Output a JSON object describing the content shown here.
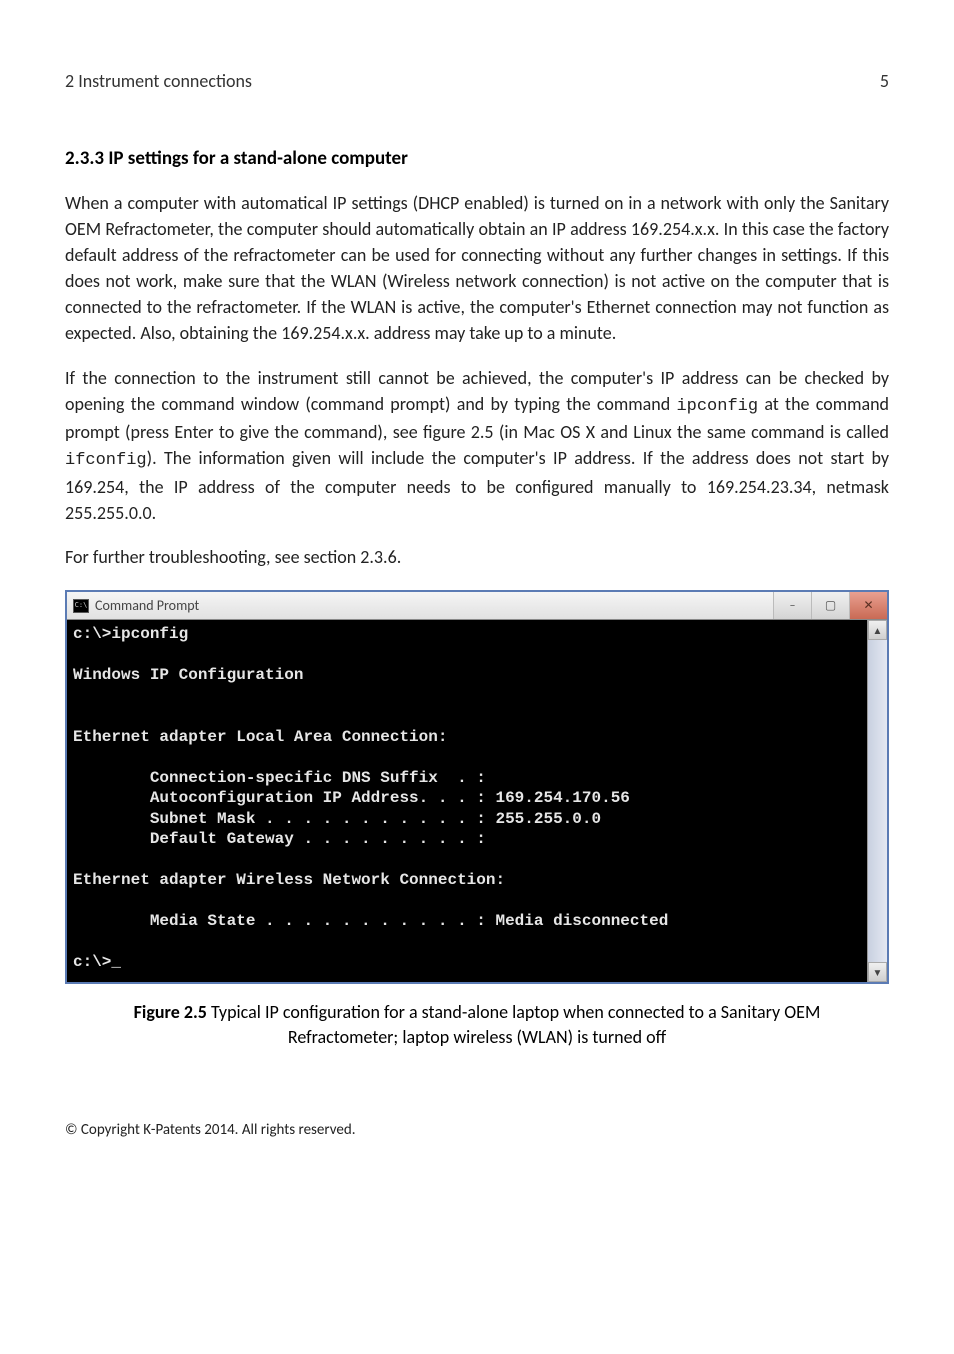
{
  "header": {
    "chapter": "2 Instrument connections",
    "page_number": "5"
  },
  "section": {
    "heading": "2.3.3   IP settings for a stand-alone computer"
  },
  "paragraphs": {
    "p1": "When a computer with automatical IP settings (DHCP enabled) is turned on in a network with only the Sanitary OEM Refractometer, the computer should automatically obtain an IP address 169.254.x.x. In this case the factory default address of the refractometer can be used for connecting without any further changes in settings. If this does not work, make sure that the WLAN (Wireless network connection) is not active on the computer that is connected to the refractometer. If the WLAN is active, the computer's Ethernet connection may not function as expected. Also, obtaining the 169.254.x.x. address may take up to a minute.",
    "p2a": "If the connection to the instrument still cannot be achieved, the computer's IP address can be checked by opening the command window (command prompt) and by typing the command ",
    "p2_code1": "ipconfig",
    "p2b": " at the command prompt (press Enter to give the command), see figure 2.5 (in Mac OS X and Linux the same command is called ",
    "p2_code2": "ifconfig",
    "p2c": "). The information given will include the computer's IP address. If the address does not start by 169.254, the IP address of the computer needs to be configured manually to 169.254.23.34, netmask 255.255.0.0.",
    "p3": "For further troubleshooting, see section 2.3.6."
  },
  "cmd": {
    "icon_label": "C:\\",
    "title": "Command Prompt",
    "minimize": "–",
    "maximize": "▢",
    "close": "✕",
    "scroll_up": "▲",
    "scroll_down": "▼",
    "content": "c:\\>ipconfig\n\nWindows IP Configuration\n\n\nEthernet adapter Local Area Connection:\n\n        Connection-specific DNS Suffix  . :\n        Autoconfiguration IP Address. . . : 169.254.170.56\n        Subnet Mask . . . . . . . . . . . : 255.255.0.0\n        Default Gateway . . . . . . . . . :\n\nEthernet adapter Wireless Network Connection:\n\n        Media State . . . . . . . . . . . : Media disconnected\n\nc:\\>_"
  },
  "figure": {
    "label": "Figure 2.5",
    "caption": "   Typical IP configuration for a stand-alone laptop when connected to a Sanitary OEM Refractometer; laptop wireless (WLAN) is turned off"
  },
  "footer": {
    "copyright": "© Copyright K-Patents 2014. All rights reserved."
  }
}
